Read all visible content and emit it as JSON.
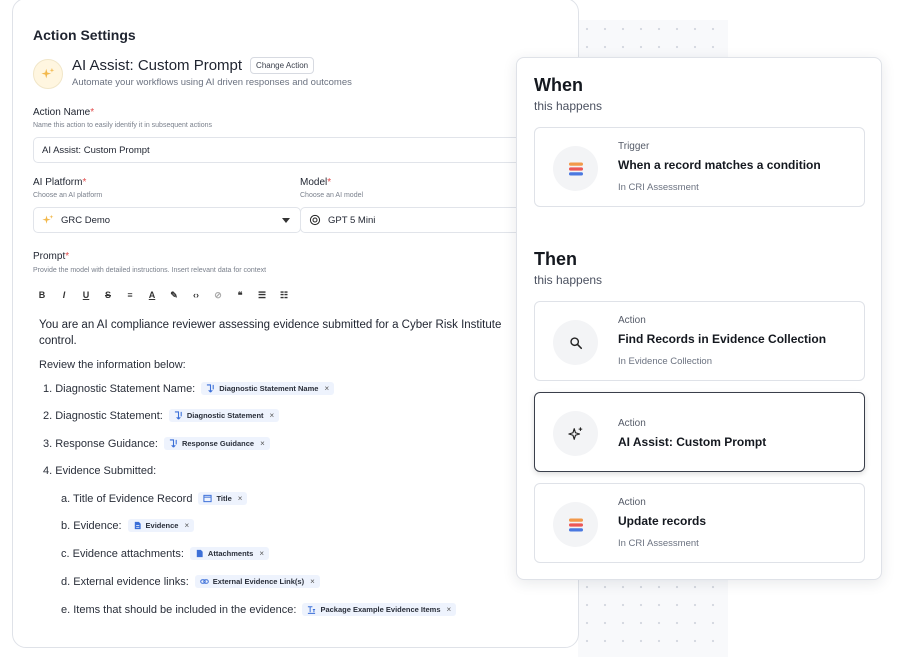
{
  "settings": {
    "title": "Action Settings",
    "action_title": "AI Assist: Custom Prompt",
    "change_action": "Change Action",
    "action_subtitle": "Automate your workflows using AI driven responses and outcomes",
    "action_name": {
      "label": "Action Name",
      "hint": "Name this action to easily identify it in subsequent actions",
      "value": "AI Assist: Custom Prompt"
    },
    "platform": {
      "label": "AI Platform",
      "hint": "Choose an AI platform",
      "value": "GRC Demo"
    },
    "model": {
      "label": "Model",
      "hint": "Choose an AI model",
      "value": "GPT 5 Mini"
    },
    "prompt": {
      "label": "Prompt",
      "hint": "Provide the model with detailed instructions. Insert relevant data for context",
      "toolbar": [
        "B",
        "I",
        "U",
        "S",
        "≡",
        "A",
        "✎",
        "‹›",
        "⊘",
        "❝",
        "☰",
        "☷"
      ],
      "intro_line1": "You are an AI compliance reviewer assessing evidence submitted for a Cyber Risk Institute",
      "intro_line2": "control.",
      "review": "Review the information below:",
      "items": [
        {
          "text": "1. Diagnostic Statement Name:",
          "chip": "Diagnostic Statement Name"
        },
        {
          "text": "2. Diagnostic Statement:",
          "chip": "Diagnostic Statement"
        },
        {
          "text": "3. Response Guidance:",
          "chip": "Response Guidance"
        },
        {
          "text": "4. Evidence Submitted:",
          "chip": ""
        }
      ],
      "subitems": [
        {
          "text": "a. Title of Evidence Record",
          "chip": "Title"
        },
        {
          "text": "b. Evidence:",
          "chip": "Evidence"
        },
        {
          "text": "c. Evidence attachments:",
          "chip": "Attachments"
        },
        {
          "text": "d. External evidence links:",
          "chip": "External Evidence Link(s)"
        },
        {
          "text": "e. Items that should be included in the evidence:",
          "chip": "Package Example Evidence Items"
        }
      ],
      "chip_remove": "×"
    },
    "required_mark": "*"
  },
  "flow": {
    "when_title": "When",
    "when_sub": "this happens",
    "then_title": "Then",
    "then_sub": "this happens",
    "trigger": {
      "kind": "Trigger",
      "title": "When a record matches a condition",
      "meta": "In CRI Assessment"
    },
    "actions": [
      {
        "kind": "Action",
        "title": "Find Records in Evidence Collection",
        "meta": "In Evidence Collection"
      },
      {
        "kind": "Action",
        "title": "AI Assist: Custom Prompt",
        "meta": ""
      },
      {
        "kind": "Action",
        "title": "Update records",
        "meta": "In CRI Assessment"
      }
    ]
  },
  "colors": {
    "required": "#e14b4b",
    "chip_bg": "#eef3fd",
    "chip_icon": "#3b6fd8",
    "logo_orange": "#f2994a",
    "logo_red": "#eb5757",
    "logo_blue": "#4a78e0"
  }
}
